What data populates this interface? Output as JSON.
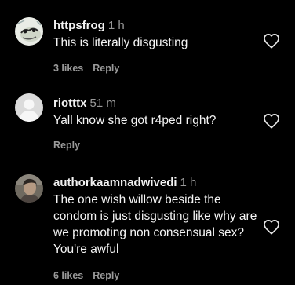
{
  "comments": [
    {
      "username": "httpsfrog",
      "time": "1 h",
      "text": "This is literally disgusting",
      "likes": "3 likes",
      "reply": "Reply",
      "avatar_icon": "frog-photo-avatar",
      "like_icon": "heart-outline-icon"
    },
    {
      "username": "riotttx",
      "time": "51 m",
      "text": "Yall know she got r4ped right?",
      "likes": "",
      "reply": "Reply",
      "avatar_icon": "default-user-avatar",
      "like_icon": "heart-outline-icon"
    },
    {
      "username": "authorkaamnadwivedi",
      "time": "1 h",
      "text": "The one wish willow beside the condom is just disgusting like why are we promoting non consensual sex? You're awful",
      "likes": "6 likes",
      "reply": "Reply",
      "avatar_icon": "person-photo-avatar",
      "like_icon": "heart-outline-icon"
    }
  ],
  "colors": {
    "background": "#000000",
    "primary_text": "#f5f5f5",
    "secondary_text": "#9a9a9a"
  }
}
